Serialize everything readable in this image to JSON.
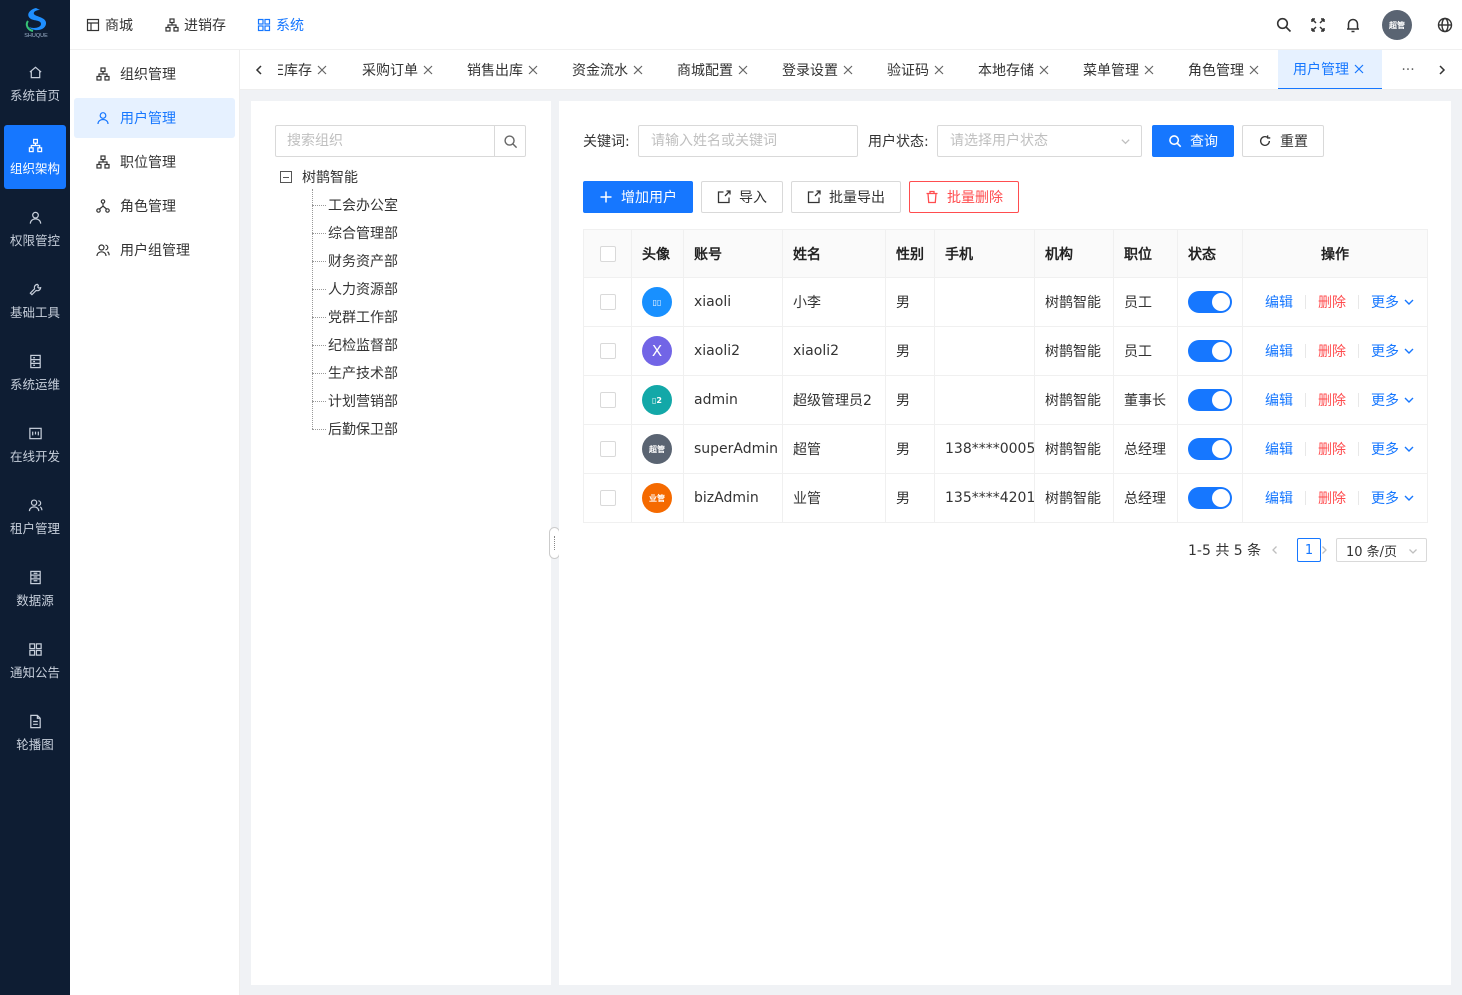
{
  "brand": {
    "logo_text": "SHUQUE"
  },
  "rail": {
    "items": [
      {
        "label": "系统首页",
        "icon": "home-icon"
      },
      {
        "label": "组织架构",
        "icon": "org-tree-icon",
        "active": true
      },
      {
        "label": "权限管控",
        "icon": "user-icon"
      },
      {
        "label": "基础工具",
        "icon": "wrench-icon"
      },
      {
        "label": "系统运维",
        "icon": "server-icon"
      },
      {
        "label": "在线开发",
        "icon": "dashboard-icon"
      },
      {
        "label": "租户管理",
        "icon": "team-icon"
      },
      {
        "label": "数据源",
        "icon": "database-icon"
      },
      {
        "label": "通知公告",
        "icon": "grid-icon"
      },
      {
        "label": "轮播图",
        "icon": "file-icon"
      }
    ]
  },
  "header": {
    "nav": [
      {
        "label": "商城",
        "icon": "shop-icon"
      },
      {
        "label": "进销存",
        "icon": "cluster-icon"
      },
      {
        "label": "系统",
        "icon": "apps-icon",
        "active": true
      }
    ],
    "avatar_text": "超管"
  },
  "submenu": {
    "items": [
      {
        "label": "组织管理",
        "icon": "cluster-icon"
      },
      {
        "label": "用户管理",
        "icon": "user-icon",
        "active": true
      },
      {
        "label": "职位管理",
        "icon": "cluster-icon"
      },
      {
        "label": "角色管理",
        "icon": "branch-icon"
      },
      {
        "label": "用户组管理",
        "icon": "usergroup-icon"
      }
    ]
  },
  "tabs": {
    "items": [
      "E库存",
      "采购订单",
      "销售出库",
      "资金流水",
      "商城配置",
      "登录设置",
      "验证码",
      "本地存储",
      "菜单管理",
      "角色管理",
      "用户管理"
    ],
    "active": "用户管理",
    "more": "···"
  },
  "tree": {
    "search_placeholder": "搜索组织",
    "root": "树鹊智能",
    "children": [
      "工会办公室",
      "综合管理部",
      "财务资产部",
      "人力资源部",
      "党群工作部",
      "纪检监督部",
      "生产技术部",
      "计划营销部",
      "后勤保卫部"
    ]
  },
  "filters": {
    "keyword_label": "关键词:",
    "keyword_placeholder": "请输入姓名或关键词",
    "status_label": "用户状态:",
    "status_placeholder": "请选择用户状态",
    "query_label": "查询",
    "reset_label": "重置"
  },
  "toolbar": {
    "add_label": "增加用户",
    "import_label": "导入",
    "export_label": "批量导出",
    "delete_label": "批量删除"
  },
  "table": {
    "columns": [
      "头像",
      "账号",
      "姓名",
      "性别",
      "手机",
      "机构",
      "职位",
      "状态",
      "操作"
    ],
    "action_labels": {
      "edit": "编辑",
      "delete": "删除",
      "more": "更多"
    },
    "rows": [
      {
        "avatar_text": "▯▯",
        "avatar_color": "#1890ff",
        "account": "xiaoli",
        "name": "小李",
        "gender": "男",
        "phone": "",
        "org": "树鹊智能",
        "position": "员工",
        "enabled": true
      },
      {
        "avatar_text": "X",
        "avatar_color": "#7265e6",
        "account": "xiaoli2",
        "name": "xiaoli2",
        "gender": "男",
        "phone": "",
        "org": "树鹊智能",
        "position": "员工",
        "enabled": true
      },
      {
        "avatar_text": "▯2",
        "avatar_color": "#13a8a8",
        "account": "admin",
        "name": "超级管理员2",
        "gender": "男",
        "phone": "",
        "org": "树鹊智能",
        "position": "董事长",
        "enabled": true
      },
      {
        "avatar_text": "超管",
        "avatar_color": "#5a6472",
        "account": "superAdmin",
        "name": "超管",
        "gender": "男",
        "phone": "138****0005",
        "org": "树鹊智能",
        "position": "总经理",
        "enabled": true
      },
      {
        "avatar_text": "业管",
        "avatar_color": "#f56a00",
        "account": "bizAdmin",
        "name": "业管",
        "gender": "男",
        "phone": "135****4201",
        "org": "树鹊智能",
        "position": "总经理",
        "enabled": true
      }
    ]
  },
  "pagination": {
    "summary": "1-5 共 5 条",
    "current": "1",
    "page_size": "10 条/页"
  },
  "colors": {
    "primary": "#1677ff",
    "danger": "#ff4d4f",
    "rail_bg": "#0e1d33"
  }
}
